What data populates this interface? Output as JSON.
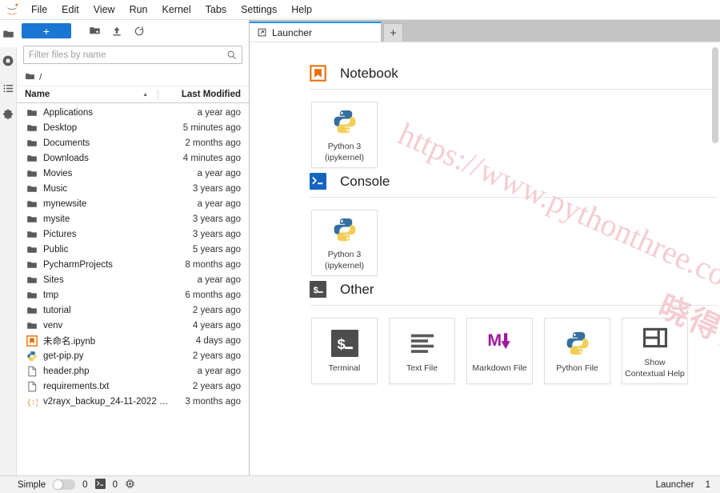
{
  "menubar": {
    "logo": "jupyter-logo",
    "items": [
      {
        "label": "File"
      },
      {
        "label": "Edit"
      },
      {
        "label": "View"
      },
      {
        "label": "Run"
      },
      {
        "label": "Kernel"
      },
      {
        "label": "Tabs"
      },
      {
        "label": "Settings"
      },
      {
        "label": "Help"
      }
    ]
  },
  "sidebar": {
    "items": [
      {
        "name": "file-browser",
        "icon": "folder-icon",
        "active": true
      },
      {
        "name": "running-terminals",
        "icon": "running-circle-icon",
        "active": false
      },
      {
        "name": "commands",
        "icon": "list-icon",
        "active": false
      },
      {
        "name": "extensions",
        "icon": "puzzle-piece-icon",
        "active": false
      }
    ]
  },
  "browser": {
    "toolbar": {
      "new_label": "+",
      "new_folder_icon": "new-folder-icon",
      "upload_icon": "upload-icon",
      "refresh_icon": "refresh-icon"
    },
    "filter": {
      "placeholder": "Filter files by name",
      "value": "",
      "icon": "search-icon"
    },
    "breadcrumb": {
      "root_icon": "folder-icon",
      "path": "/"
    },
    "columns": {
      "name": "Name",
      "last_modified": "Last Modified",
      "sort_direction": "asc"
    },
    "files": [
      {
        "name": "Applications",
        "modified": "a year ago",
        "type": "folder"
      },
      {
        "name": "Desktop",
        "modified": "5 minutes ago",
        "type": "folder"
      },
      {
        "name": "Documents",
        "modified": "2 months ago",
        "type": "folder"
      },
      {
        "name": "Downloads",
        "modified": "4 minutes ago",
        "type": "folder"
      },
      {
        "name": "Movies",
        "modified": "a year ago",
        "type": "folder"
      },
      {
        "name": "Music",
        "modified": "3 years ago",
        "type": "folder"
      },
      {
        "name": "mynewsite",
        "modified": "a year ago",
        "type": "folder"
      },
      {
        "name": "mysite",
        "modified": "3 years ago",
        "type": "folder"
      },
      {
        "name": "Pictures",
        "modified": "3 years ago",
        "type": "folder"
      },
      {
        "name": "Public",
        "modified": "5 years ago",
        "type": "folder"
      },
      {
        "name": "PycharmProjects",
        "modified": "8 months ago",
        "type": "folder"
      },
      {
        "name": "Sites",
        "modified": "a year ago",
        "type": "folder"
      },
      {
        "name": "tmp",
        "modified": "6 months ago",
        "type": "folder"
      },
      {
        "name": "tutorial",
        "modified": "2 years ago",
        "type": "folder"
      },
      {
        "name": "venv",
        "modified": "4 years ago",
        "type": "folder"
      },
      {
        "name": "未命名.ipynb",
        "modified": "4 days ago",
        "type": "notebook"
      },
      {
        "name": "get-pip.py",
        "modified": "2 years ago",
        "type": "python"
      },
      {
        "name": "header.php",
        "modified": "a year ago",
        "type": "file"
      },
      {
        "name": "requirements.txt",
        "modified": "2 years ago",
        "type": "file"
      },
      {
        "name": "v2rayx_backup_24-11-2022 …",
        "modified": "3 months ago",
        "type": "json"
      }
    ]
  },
  "main": {
    "tab": {
      "label": "Launcher",
      "icon": "launcher-icon"
    },
    "add_tab_label": "+",
    "launcher": {
      "sections": [
        {
          "title": "Notebook",
          "icon": "notebook-icon",
          "cards": [
            {
              "line1": "Python 3",
              "line2": "(ipykernel)",
              "icon": "python-icon"
            }
          ]
        },
        {
          "title": "Console",
          "icon": "console-icon",
          "cards": [
            {
              "line1": "Python 3",
              "line2": "(ipykernel)",
              "icon": "python-icon"
            }
          ]
        },
        {
          "title": "Other",
          "icon": "terminal-icon",
          "cards": [
            {
              "line1": "Terminal",
              "line2": "",
              "icon": "terminal-icon"
            },
            {
              "line1": "Text File",
              "line2": "",
              "icon": "text-file-icon"
            },
            {
              "line1": "Markdown File",
              "line2": "",
              "icon": "markdown-icon"
            },
            {
              "line1": "Python File",
              "line2": "",
              "icon": "python-icon"
            },
            {
              "line1": "Show",
              "line2": "Contextual Help",
              "icon": "contextual-help-icon"
            }
          ]
        }
      ]
    }
  },
  "statusbar": {
    "simple_label": "Simple",
    "simple_on": false,
    "kernel_count": "0",
    "terminal_icon": "terminal-icon",
    "terminal_count": "0",
    "cpu_icon": "cpu-icon",
    "active_tab": "Launcher",
    "tab_index": "1"
  },
  "watermark": {
    "line1": "https://www.pythonthree.com",
    "line2": "晓得博客",
    "color": "#f3c5cc"
  }
}
